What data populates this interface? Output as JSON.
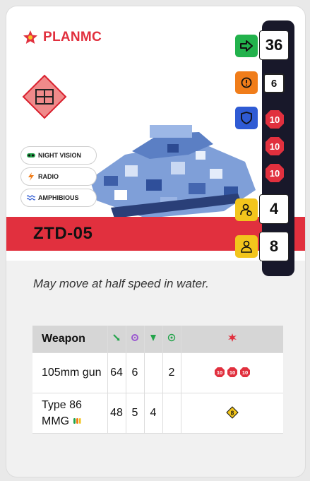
{
  "faction": {
    "name": "PLANMC",
    "icon": "star-icon"
  },
  "unit": {
    "name": "ZTD-05",
    "description": "May move at half speed in water."
  },
  "tags": [
    {
      "label": "NIGHT VISION",
      "icon": "night-vision-icon"
    },
    {
      "label": "RADIO",
      "icon": "radio-icon"
    },
    {
      "label": "AMPHIBIOUS",
      "icon": "amphibious-icon"
    }
  ],
  "stats": {
    "move": "36",
    "morale": "6",
    "armor": [
      "10",
      "10",
      "10"
    ],
    "crew": "4",
    "infantry": "8"
  },
  "weapons": {
    "header": {
      "name": "Weapon"
    },
    "rows": [
      {
        "name": "105mm gun",
        "range": "64",
        "accuracy": "6",
        "penetration": "",
        "rof": "2",
        "damage": [
          "10",
          "10",
          "10"
        ]
      },
      {
        "name": "Type 86 MMG",
        "range": "48",
        "accuracy": "5",
        "penetration": "4",
        "rof": "",
        "damage": [
          "8"
        ]
      }
    ]
  },
  "colors": {
    "accent": "#e1303e",
    "strip": "#18182a",
    "move": "#22b24c",
    "morale": "#f07d1a",
    "armor": "#2f5bd4",
    "crew": "#f2c51c"
  }
}
